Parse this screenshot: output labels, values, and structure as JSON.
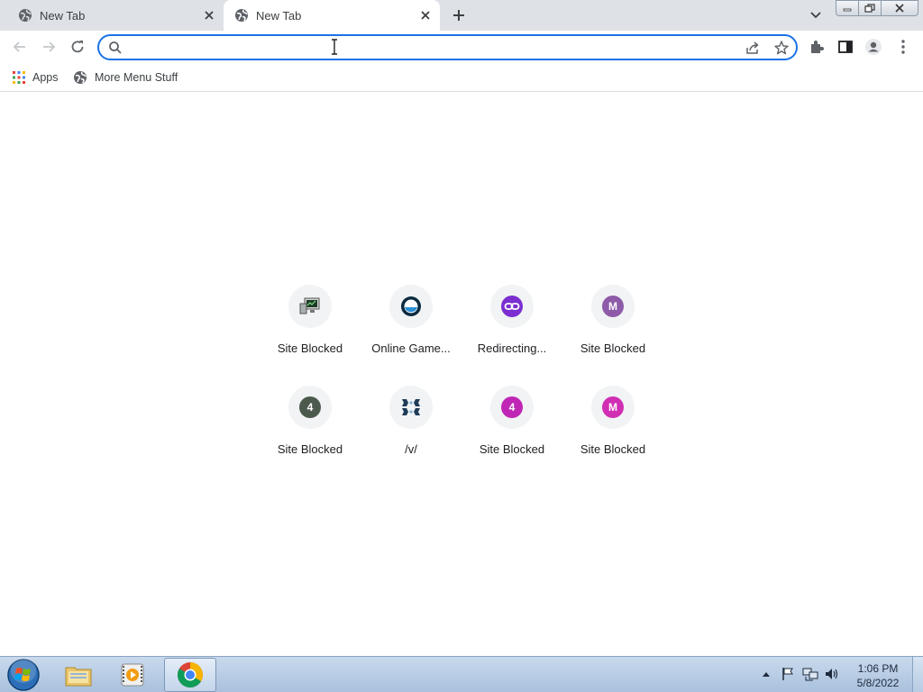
{
  "tabs": [
    {
      "title": "New Tab",
      "active": false
    },
    {
      "title": "New Tab",
      "active": true
    }
  ],
  "omnibox": {
    "value": "",
    "placeholder": ""
  },
  "bookmarks": [
    {
      "label": "Apps",
      "icon": "apps-grid-icon"
    },
    {
      "label": "More Menu Stuff",
      "icon": "globe-icon"
    }
  ],
  "shortcuts": [
    {
      "label": "Site Blocked",
      "icon": "monitor-chart-icon"
    },
    {
      "label": "Online Game...",
      "icon": "blue-ring-icon"
    },
    {
      "label": "Redirecting...",
      "icon": "link-icon"
    },
    {
      "label": "Site Blocked",
      "icon": "letter-m-icon",
      "letter": "M",
      "color": "#8e5ba8"
    },
    {
      "label": "Site Blocked",
      "icon": "letter-4-icon",
      "letter": "4",
      "color": "#4c5a4d"
    },
    {
      "label": "/v/",
      "icon": "pattern-icon"
    },
    {
      "label": "Site Blocked",
      "icon": "letter-4-icon",
      "letter": "4",
      "color": "#c026b5"
    },
    {
      "label": "Site Blocked",
      "icon": "letter-m-icon",
      "letter": "M",
      "color": "#d02fb4"
    }
  ],
  "taskbar": {
    "apps": [
      "explorer-folder-icon",
      "media-player-icon",
      "chrome-icon"
    ],
    "time": "1:06 PM",
    "date": "5/8/2022"
  },
  "colors": {
    "accent": "#1a73e8",
    "tabstrip": "#dee1e6"
  }
}
